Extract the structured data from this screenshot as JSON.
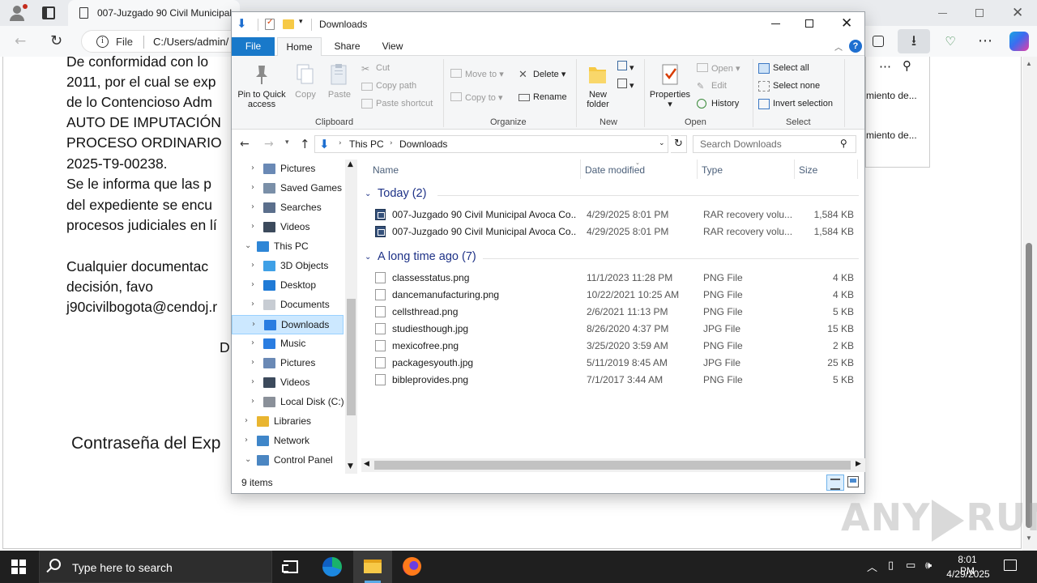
{
  "browser": {
    "tab_title": "007-Juzgado 90 Civil Municipal",
    "address_scheme": "File",
    "address_url": "C:/Users/admin/"
  },
  "document": {
    "lines": [
      "De conformidad con lo",
      "2011, por el cual se exp",
      "de lo Contencioso Adm",
      "AUTO DE IMPUTACIÓN",
      "PROCESO ORDINARIO",
      "2025-T9-00238.",
      "Se le informa que las p",
      "del expediente se encu",
      "procesos judiciales en lí",
      "Cualquier documentac",
      "decisión,           favo",
      "j90civilbogota@cendoj.r",
      "D"
    ],
    "password_label": "Contraseña del Exp",
    "side_panel_items": [
      "miento de...",
      "miento de..."
    ]
  },
  "explorer": {
    "title": "Downloads",
    "ribbon_tabs": {
      "file": "File",
      "home": "Home",
      "share": "Share",
      "view": "View"
    },
    "ribbon": {
      "clipboard": {
        "label": "Clipboard",
        "pin": "Pin to Quick access",
        "copy": "Copy",
        "paste": "Paste",
        "cut": "Cut",
        "copy_path": "Copy path",
        "paste_shortcut": "Paste shortcut"
      },
      "organize": {
        "label": "Organize",
        "move_to": "Move to",
        "copy_to": "Copy to",
        "delete": "Delete",
        "rename": "Rename"
      },
      "new": {
        "label": "New",
        "new_folder": "New folder"
      },
      "open": {
        "label": "Open",
        "properties": "Properties",
        "open": "Open",
        "edit": "Edit",
        "history": "History"
      },
      "select": {
        "label": "Select",
        "select_all": "Select all",
        "select_none": "Select none",
        "invert": "Invert selection"
      }
    },
    "breadcrumb": [
      "This PC",
      "Downloads"
    ],
    "search_placeholder": "Search Downloads",
    "nav_items": [
      {
        "label": "Pictures",
        "icon": "pictures-icon",
        "indent": 1
      },
      {
        "label": "Saved Games",
        "icon": "saved-games-icon",
        "indent": 1
      },
      {
        "label": "Searches",
        "icon": "searches-icon",
        "indent": 1
      },
      {
        "label": "Videos",
        "icon": "videos-icon",
        "indent": 1
      },
      {
        "label": "This PC",
        "icon": "this-pc-icon",
        "indent": 0
      },
      {
        "label": "3D Objects",
        "icon": "3d-objects-icon",
        "indent": 1
      },
      {
        "label": "Desktop",
        "icon": "desktop-icon",
        "indent": 1
      },
      {
        "label": "Documents",
        "icon": "documents-icon",
        "indent": 1
      },
      {
        "label": "Downloads",
        "icon": "downloads-icon",
        "indent": 1,
        "selected": true
      },
      {
        "label": "Music",
        "icon": "music-icon",
        "indent": 1
      },
      {
        "label": "Pictures",
        "icon": "pictures-icon",
        "indent": 1
      },
      {
        "label": "Videos",
        "icon": "videos-icon",
        "indent": 1
      },
      {
        "label": "Local Disk (C:)",
        "icon": "local-disk-icon",
        "indent": 1
      },
      {
        "label": "Libraries",
        "icon": "libraries-icon",
        "indent": 0
      },
      {
        "label": "Network",
        "icon": "network-icon",
        "indent": 0
      },
      {
        "label": "Control Panel",
        "icon": "control-panel-icon",
        "indent": 0
      }
    ],
    "columns": {
      "name": "Name",
      "date": "Date modified",
      "type": "Type",
      "size": "Size"
    },
    "groups": [
      {
        "label": "Today (2)",
        "files": [
          {
            "name": "007-Juzgado 90 Civil Municipal Avoca Co...",
            "date": "4/29/2025 8:01 PM",
            "type": "RAR recovery volu...",
            "size": "1,584 KB",
            "icon": "rar-icon"
          },
          {
            "name": "007-Juzgado 90 Civil Municipal Avoca Co...",
            "date": "4/29/2025 8:01 PM",
            "type": "RAR recovery volu...",
            "size": "1,584 KB",
            "icon": "rar-icon"
          }
        ]
      },
      {
        "label": "A long time ago (7)",
        "files": [
          {
            "name": "classesstatus.png",
            "date": "11/1/2023 11:28 PM",
            "type": "PNG File",
            "size": "4 KB",
            "icon": "image-file-icon"
          },
          {
            "name": "dancemanufacturing.png",
            "date": "10/22/2021 10:25 AM",
            "type": "PNG File",
            "size": "4 KB",
            "icon": "image-file-icon"
          },
          {
            "name": "cellsthread.png",
            "date": "2/6/2021 11:13 PM",
            "type": "PNG File",
            "size": "5 KB",
            "icon": "image-file-icon"
          },
          {
            "name": "studiesthough.jpg",
            "date": "8/26/2020 4:37 PM",
            "type": "JPG File",
            "size": "15 KB",
            "icon": "image-file-icon"
          },
          {
            "name": "mexicofree.png",
            "date": "3/25/2020 3:59 AM",
            "type": "PNG File",
            "size": "2 KB",
            "icon": "image-file-icon"
          },
          {
            "name": "packagesyouth.jpg",
            "date": "5/11/2019 8:45 AM",
            "type": "JPG File",
            "size": "25 KB",
            "icon": "image-file-icon"
          },
          {
            "name": "bibleprovides.png",
            "date": "7/1/2017 3:44 AM",
            "type": "PNG File",
            "size": "5 KB",
            "icon": "image-file-icon"
          }
        ]
      }
    ],
    "status_count": "9 items"
  },
  "watermark": {
    "left": "ANY",
    "right": "RUN"
  },
  "taskbar": {
    "search_placeholder": "Type here to search",
    "clock_time": "8:01 PM",
    "clock_date": "4/29/2025"
  },
  "colors": {
    "file_tab": "#1979ca",
    "selection": "#cce8ff",
    "group_header": "#1e3287",
    "taskbar": "#1f1f1f"
  }
}
